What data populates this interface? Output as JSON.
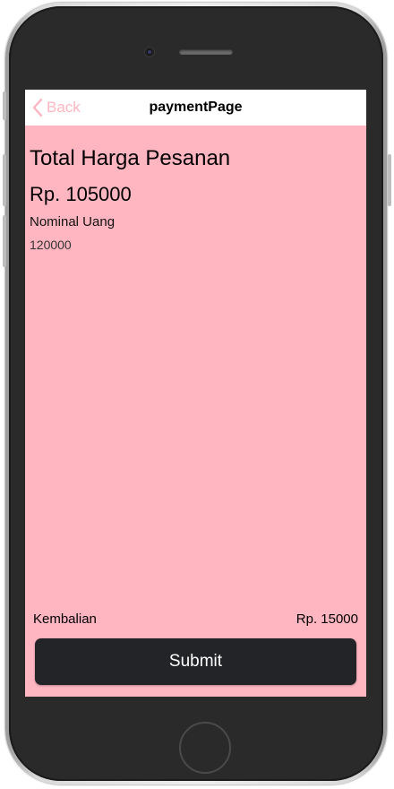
{
  "nav": {
    "back_label": "Back",
    "title": "paymentPage"
  },
  "payment": {
    "heading": "Total Harga Pesanan",
    "total_amount": "Rp. 105000",
    "cash_label": "Nominal Uang",
    "cash_value": "120000",
    "change_label": "Kembalian",
    "change_value": "Rp. 15000"
  },
  "actions": {
    "submit_label": "Submit"
  },
  "colors": {
    "screen_background": "#ffb6c1",
    "accent": "#ffb6c1",
    "button_background": "#232427",
    "button_text": "#ffffff"
  },
  "icons": {
    "back": "chevron-left-icon"
  }
}
